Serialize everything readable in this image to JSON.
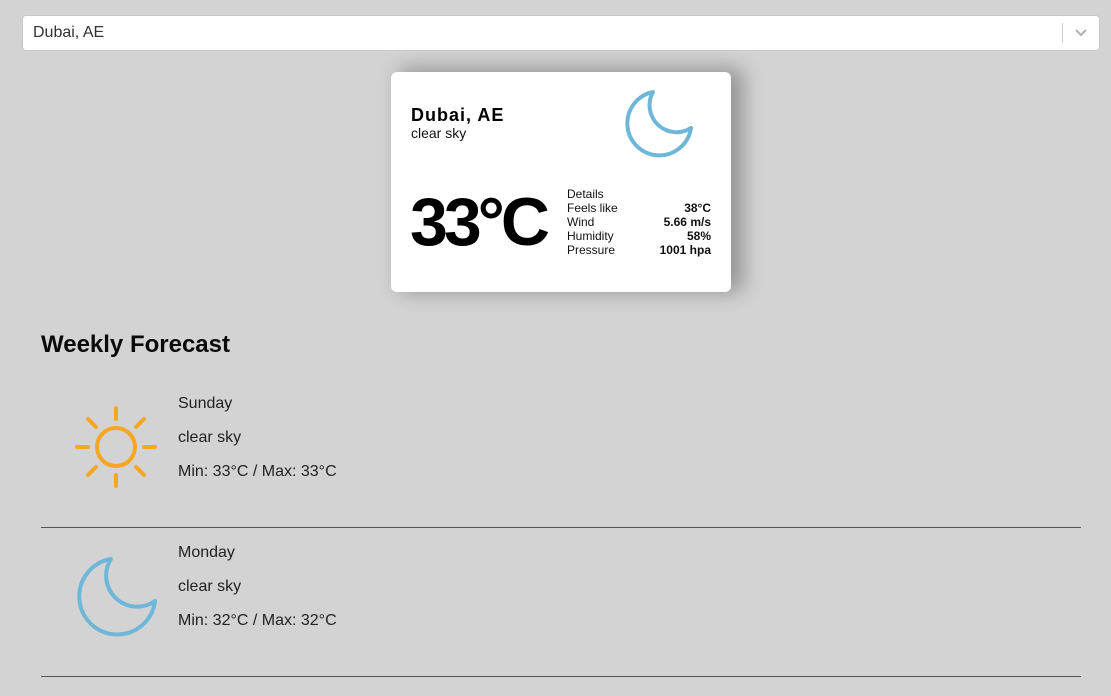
{
  "search": {
    "selected": "Dubai, AE"
  },
  "current": {
    "city": "Dubai, AE",
    "description": "clear sky",
    "temperature": "33°C",
    "icon": "moon-icon",
    "details": {
      "heading": "Details",
      "rows": [
        {
          "label": "Feels like",
          "value": "38°C"
        },
        {
          "label": "Wind",
          "value": "5.66 m/s"
        },
        {
          "label": "Humidity",
          "value": "58%"
        },
        {
          "label": "Pressure",
          "value": "1001 hpa"
        }
      ]
    }
  },
  "weekly": {
    "title": "Weekly Forecast",
    "days": [
      {
        "day": "Sunday",
        "description": "clear sky",
        "temp": "Min: 33°C / Max: 33°C",
        "icon": "sun-icon"
      },
      {
        "day": "Monday",
        "description": "clear sky",
        "temp": "Min: 32°C / Max: 32°C",
        "icon": "moon-icon"
      }
    ]
  },
  "colors": {
    "background": "#d3d3d3",
    "sun": "#f5a623",
    "moon": "#6fb7d8"
  }
}
